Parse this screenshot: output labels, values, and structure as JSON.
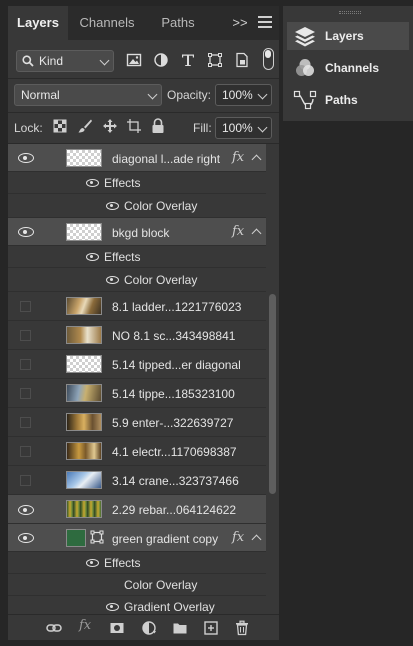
{
  "tabs": [
    {
      "label": "Layers",
      "active": true
    },
    {
      "label": "Channels",
      "active": false
    },
    {
      "label": "Paths",
      "active": false
    }
  ],
  "tabs_overflow": ">>",
  "filter": {
    "kind_label": "Kind",
    "icons": [
      "image-filter-icon",
      "adjustment-filter-icon",
      "type-filter-icon",
      "shape-filter-icon",
      "smart-object-filter-icon"
    ]
  },
  "blend": {
    "mode": "Normal",
    "opacity_label": "Opacity:",
    "opacity_value": "100%"
  },
  "lock": {
    "label": "Lock:",
    "fill_label": "Fill:",
    "fill_value": "100%"
  },
  "layers": [
    {
      "name": "diagonal l...ade right",
      "visible": true,
      "fx": "fx",
      "selected": true,
      "thumb": "checker",
      "effects_label": "Effects",
      "effects": [
        "Color Overlay"
      ]
    },
    {
      "name": "bkgd block",
      "visible": true,
      "fx": "fx",
      "selected": true,
      "thumb": "checker",
      "effects_label": "Effects",
      "effects": [
        "Color Overlay"
      ]
    },
    {
      "name": "8.1 ladder...1221776023",
      "visible": false,
      "thumb": "photo-a"
    },
    {
      "name": "NO 8.1 sc...343498841",
      "visible": false,
      "thumb": "photo-b"
    },
    {
      "name": "5.14 tipped...er diagonal",
      "visible": false,
      "thumb": "checker"
    },
    {
      "name": "5.14 tippe...185323100",
      "visible": false,
      "thumb": "photo-c"
    },
    {
      "name": "5.9 enter-...322639727",
      "visible": false,
      "thumb": "photo-d"
    },
    {
      "name": "4.1 electr...1170698387",
      "visible": false,
      "thumb": "photo-e"
    },
    {
      "name": "3.14 crane...323737466",
      "visible": false,
      "thumb": "photo-f"
    },
    {
      "name": "2.29 rebar...064124622",
      "visible": true,
      "selected": true,
      "thumb": "photo-g"
    },
    {
      "name": "green gradient copy",
      "visible": true,
      "fx": "fx",
      "selected": true,
      "thumb": "green",
      "effects_label": "Effects",
      "effects": [
        "Color Overlay",
        "Gradient Overlay"
      ]
    }
  ],
  "dock": [
    {
      "label": "Layers",
      "icon": "layers-icon",
      "active": true
    },
    {
      "label": "Channels",
      "icon": "channels-icon",
      "active": false
    },
    {
      "label": "Paths",
      "icon": "paths-icon",
      "active": false
    }
  ],
  "footer_icons": [
    "link-layers-icon",
    "fx-icon",
    "add-mask-icon",
    "adjustment-layer-icon",
    "new-group-icon",
    "new-layer-icon",
    "trash-icon"
  ],
  "footer_fx": "fx",
  "colors": {
    "panel": "#383838",
    "tabbar": "#2b2b2b",
    "selected_row": "#4e4e4e",
    "dock_active": "#4a4a4a",
    "green_thumb": "#2e6b3f"
  }
}
